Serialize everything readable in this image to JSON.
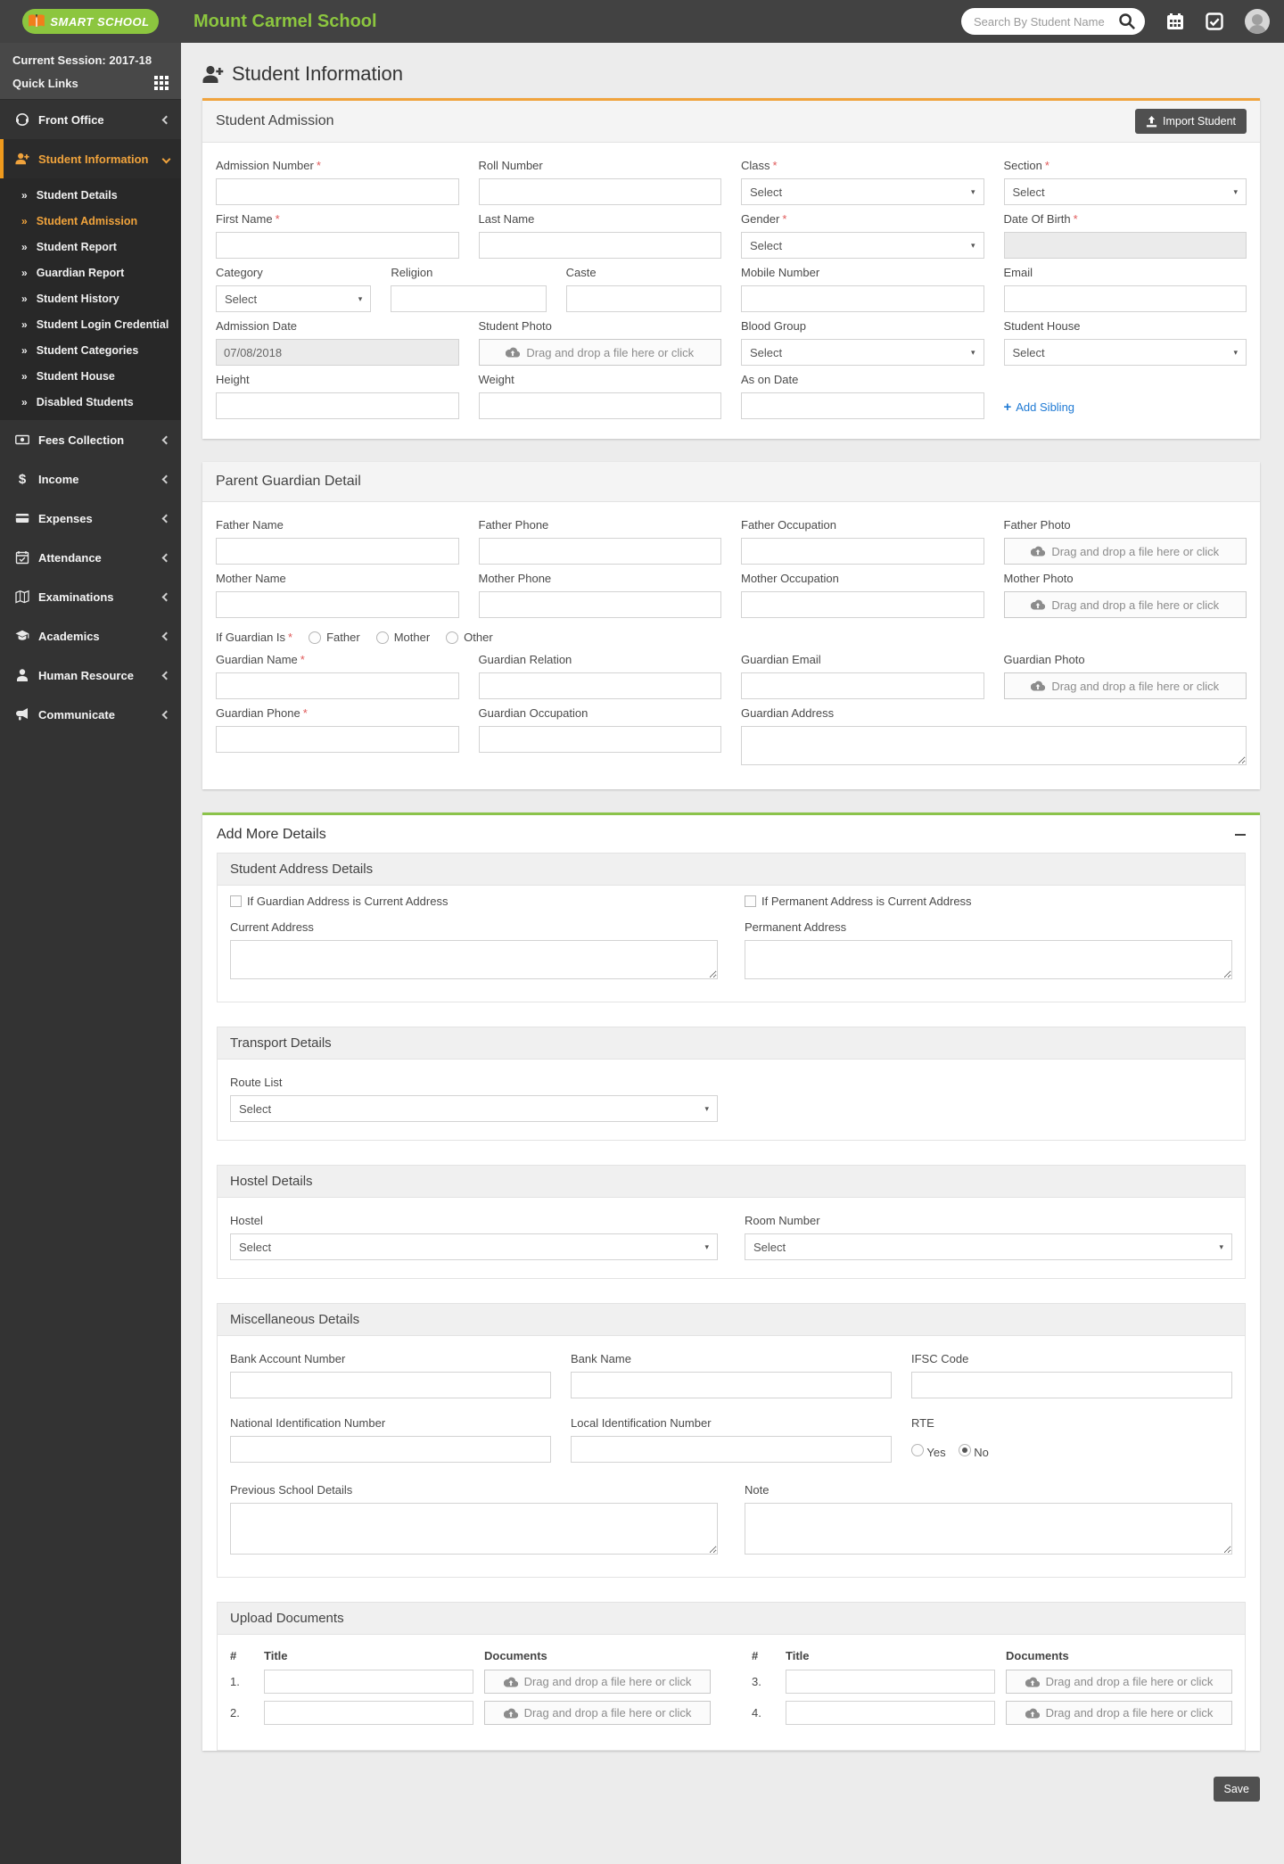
{
  "header": {
    "logo_text": "SMART SCHOOL",
    "school_name": "Mount Carmel School",
    "search_placeholder": "Search By Student Name"
  },
  "sidebar": {
    "session": "Current Session: 2017-18",
    "quick_links": "Quick Links",
    "items": [
      {
        "label": "Front Office"
      },
      {
        "label": "Student Information"
      },
      {
        "label": "Fees Collection"
      },
      {
        "label": "Income"
      },
      {
        "label": "Expenses"
      },
      {
        "label": "Attendance"
      },
      {
        "label": "Examinations"
      },
      {
        "label": "Academics"
      },
      {
        "label": "Human Resource"
      },
      {
        "label": "Communicate"
      }
    ],
    "student_information_children": [
      {
        "label": "Student Details"
      },
      {
        "label": "Student Admission"
      },
      {
        "label": "Student Report"
      },
      {
        "label": "Guardian Report"
      },
      {
        "label": "Student History"
      },
      {
        "label": "Student Login Credential"
      },
      {
        "label": "Student Categories"
      },
      {
        "label": "Student House"
      },
      {
        "label": "Disabled Students"
      }
    ]
  },
  "page": {
    "title": "Student Information"
  },
  "ui": {
    "required": "*",
    "select": "Select",
    "dropzone": "Drag and drop a file here or click",
    "caret": "▾"
  },
  "admission": {
    "title": "Student Admission",
    "import_button": "Import Student",
    "fields": {
      "admission_number": "Admission Number",
      "roll_number": "Roll Number",
      "class": "Class",
      "section": "Section",
      "first_name": "First Name",
      "last_name": "Last Name",
      "gender": "Gender",
      "dob": "Date Of Birth",
      "category": "Category",
      "religion": "Religion",
      "caste": "Caste",
      "mobile": "Mobile Number",
      "email": "Email",
      "admission_date": "Admission Date",
      "student_photo": "Student Photo",
      "blood_group": "Blood Group",
      "student_house": "Student House",
      "height": "Height",
      "weight": "Weight",
      "as_on_date": "As on Date"
    },
    "values": {
      "admission_date": "07/08/2018"
    },
    "add_sibling": "Add Sibling",
    "add_sibling_plus": "+"
  },
  "guardian": {
    "title": "Parent Guardian Detail",
    "fields": {
      "father_name": "Father Name",
      "father_phone": "Father Phone",
      "father_occupation": "Father Occupation",
      "father_photo": "Father Photo",
      "mother_name": "Mother Name",
      "mother_phone": "Mother Phone",
      "mother_occupation": "Mother Occupation",
      "mother_photo": "Mother Photo",
      "if_guardian_is": "If Guardian Is",
      "option_father": "Father",
      "option_mother": "Mother",
      "option_other": "Other",
      "guardian_name": "Guardian Name",
      "guardian_relation": "Guardian Relation",
      "guardian_email": "Guardian Email",
      "guardian_photo": "Guardian Photo",
      "guardian_phone": "Guardian Phone",
      "guardian_occupation": "Guardian Occupation",
      "guardian_address": "Guardian Address"
    }
  },
  "more": {
    "title": "Add More Details",
    "address": {
      "title": "Student Address Details",
      "checkbox_guardian": "If Guardian Address is Current Address",
      "checkbox_permanent": "If Permanent Address is Current Address",
      "current_address": "Current Address",
      "permanent_address": "Permanent Address"
    },
    "transport": {
      "title": "Transport Details",
      "route_list": "Route List"
    },
    "hostel": {
      "title": "Hostel Details",
      "hostel": "Hostel",
      "room_number": "Room Number"
    },
    "misc": {
      "title": "Miscellaneous Details",
      "bank_account": "Bank Account Number",
      "bank_name": "Bank Name",
      "ifsc": "IFSC Code",
      "national_id": "National Identification Number",
      "local_id": "Local Identification Number",
      "rte": "RTE",
      "rte_yes": "Yes",
      "rte_no": "No",
      "previous_school": "Previous School Details",
      "note": "Note"
    },
    "upload": {
      "title": "Upload Documents",
      "col_hash": "#",
      "col_title": "Title",
      "col_documents": "Documents",
      "rows": [
        {
          "num": "1."
        },
        {
          "num": "2."
        },
        {
          "num": "3."
        },
        {
          "num": "4."
        }
      ]
    }
  },
  "save_button": "Save",
  "colors": {
    "accent_orange": "#f0a33c",
    "accent_green": "#8bc34a",
    "link_blue": "#1f7ad4",
    "header_bg": "#424242",
    "sidebar_bg": "#333333"
  }
}
